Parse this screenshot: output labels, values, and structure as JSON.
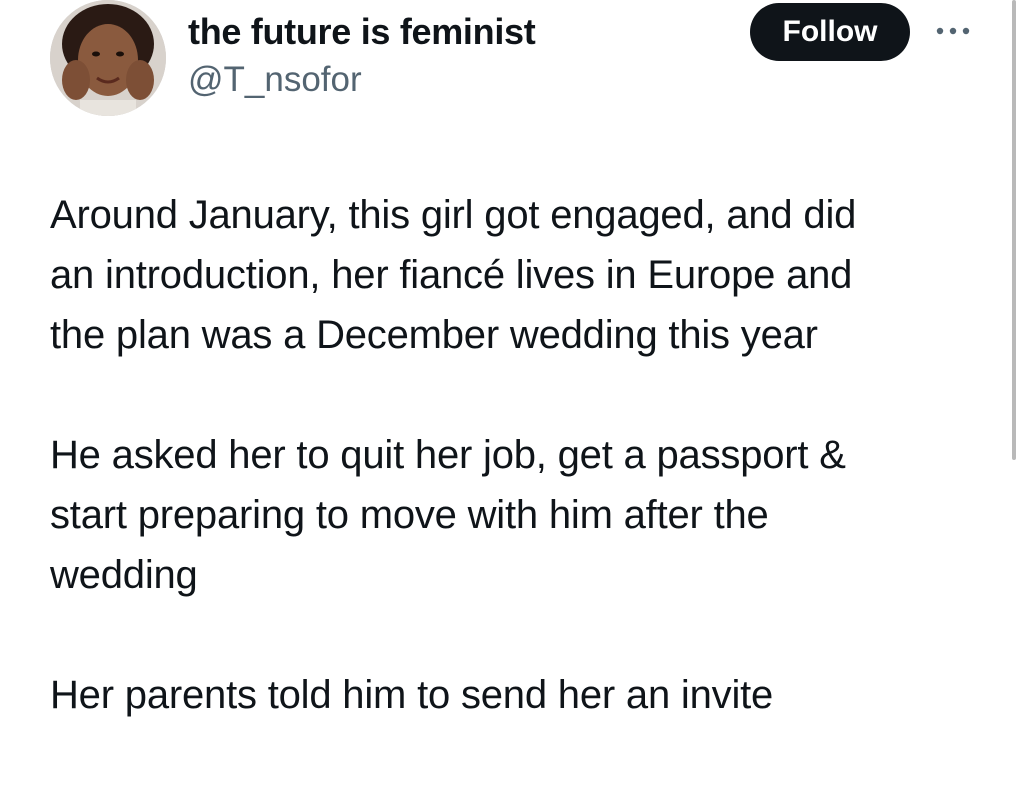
{
  "author": {
    "display_name": "the future is feminist",
    "handle": "@T_nsofor"
  },
  "actions": {
    "follow_label": "Follow",
    "more_icon": "more-horizontal-icon"
  },
  "tweet": {
    "paragraphs": [
      "Around January, this girl got engaged, and did\nan introduction, her fiancé lives in Europe and\nthe plan was a December wedding this year",
      "He asked her to quit her job, get a passport &\nstart preparing to move with him after the\nwedding",
      "Her parents told him to send her an invite"
    ]
  },
  "colors": {
    "text_primary": "#0f1419",
    "text_secondary": "#536471",
    "button_bg": "#0f1419",
    "button_text": "#ffffff"
  }
}
